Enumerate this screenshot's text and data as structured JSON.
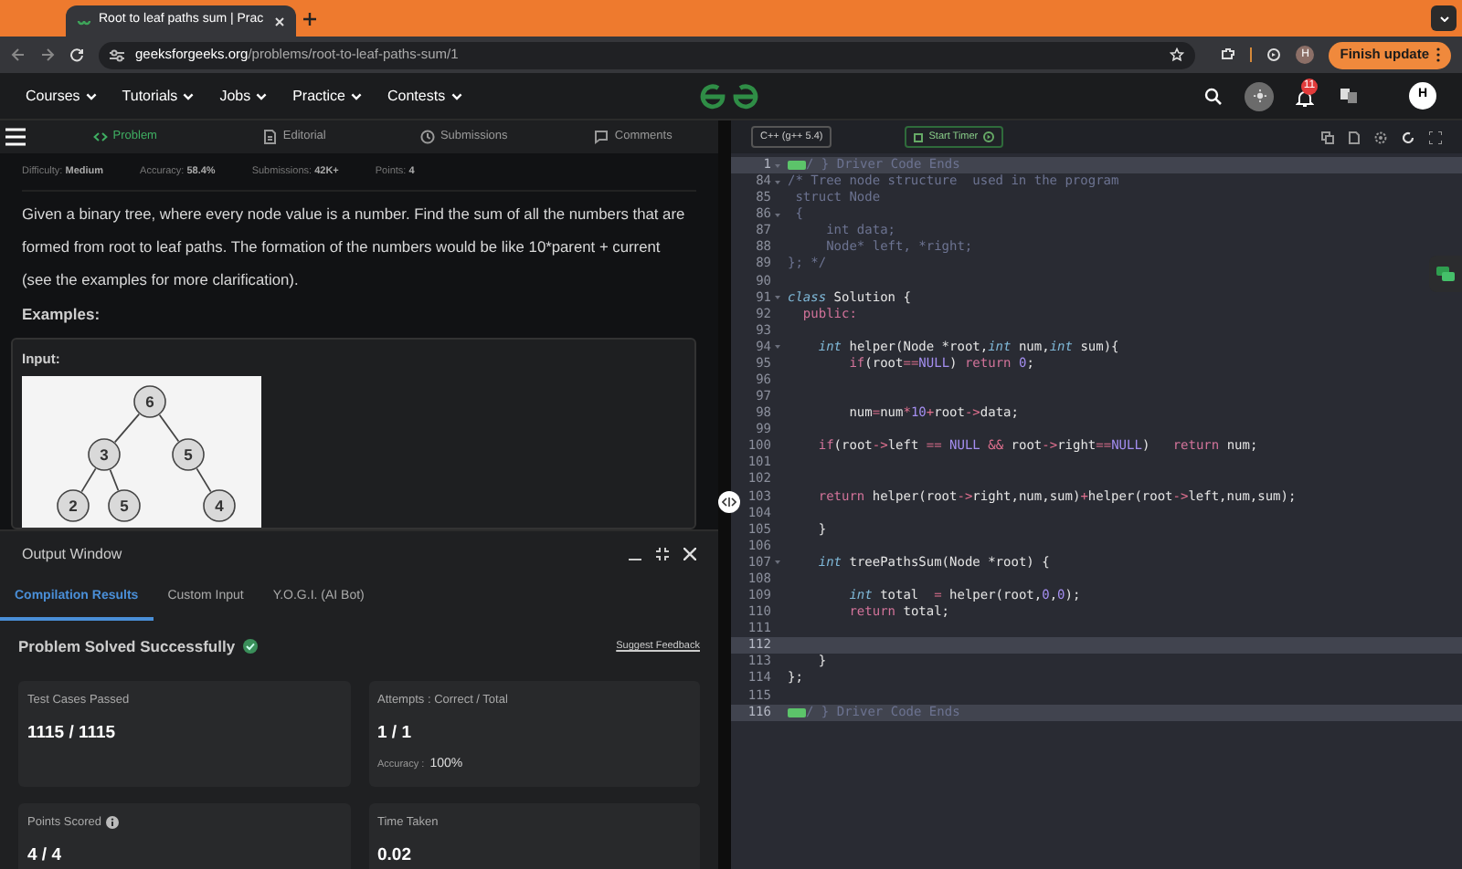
{
  "browser": {
    "tab_title": "Root to leaf paths sum | Prac",
    "url_domain": "geeksforgeeks.org",
    "url_path": "/problems/root-to-leaf-paths-sum/1",
    "profile_initial": "H",
    "update_button": "Finish update"
  },
  "site_nav": {
    "items": [
      "Courses",
      "Tutorials",
      "Jobs",
      "Practice",
      "Contests"
    ],
    "notification_count": "11",
    "avatar_initial": "H"
  },
  "problem_tabs": [
    {
      "label": "Problem",
      "kind": "code",
      "selected": true
    },
    {
      "label": "Editorial",
      "kind": "doc",
      "selected": false
    },
    {
      "label": "Submissions",
      "kind": "clock",
      "selected": false
    },
    {
      "label": "Comments",
      "kind": "chat",
      "selected": false
    }
  ],
  "meta": [
    {
      "label": "Difficulty:",
      "value": "Medium"
    },
    {
      "label": "Accuracy:",
      "value": "58.4%"
    },
    {
      "label": "Submissions:",
      "value": "42K+"
    },
    {
      "label": "Points:",
      "value": "4"
    }
  ],
  "description": "Given a binary tree, where every node value is a number. Find the sum of all the numbers that are formed from root to leaf paths. The formation of the numbers would be like 10*parent + current (see the examples for more clarification).",
  "examples_heading": "Examples:",
  "example": {
    "label": "Input:",
    "tree": {
      "value": "6",
      "children": [
        {
          "value": "3",
          "children": [
            {
              "value": "2"
            },
            {
              "value": "5"
            }
          ]
        },
        {
          "value": "5",
          "children": [
            {
              "value": "4"
            }
          ]
        }
      ]
    }
  },
  "output_window": {
    "title": "Output Window",
    "tabs": [
      {
        "label": "Compilation Results",
        "selected": true
      },
      {
        "label": "Custom Input",
        "selected": false
      },
      {
        "label": "Y.O.G.I. (AI Bot)",
        "selected": false
      }
    ],
    "status": "Problem Solved Successfully",
    "feedback_link": "Suggest Feedback",
    "cards": [
      {
        "label": "Test Cases Passed",
        "value": "1115 / 1115",
        "info": false
      },
      {
        "label": "Attempts : Correct / Total",
        "value": "1 / 1",
        "info": false,
        "extra_label": "Accuracy :",
        "extra_value": "100%"
      },
      {
        "label": "Points Scored",
        "value": "4 / 4",
        "info": true
      },
      {
        "label": "Time Taken",
        "value": "0.02",
        "info": false
      }
    ]
  },
  "editor": {
    "language": "C++ (g++ 5.4)",
    "timer_button": "Start Timer",
    "lines": [
      {
        "number": "1",
        "foldable": true,
        "folded": true,
        "highlighted": true,
        "tokens": [
          {
            "text": "/ } Driver Code Ends",
            "kind": "comment"
          }
        ]
      },
      {
        "number": "84",
        "foldable": true,
        "folded": false,
        "highlighted": false,
        "tokens": [
          {
            "text": "/* Tree node structure  used in the program",
            "kind": "comment"
          }
        ]
      },
      {
        "number": "85",
        "foldable": false,
        "folded": false,
        "highlighted": false,
        "tokens": [
          {
            "text": " struct Node",
            "kind": "comment"
          }
        ]
      },
      {
        "number": "86",
        "foldable": true,
        "folded": false,
        "highlighted": false,
        "tokens": [
          {
            "text": " {",
            "kind": "comment"
          }
        ]
      },
      {
        "number": "87",
        "foldable": false,
        "folded": false,
        "highlighted": false,
        "tokens": [
          {
            "text": "     int data;",
            "kind": "comment"
          }
        ]
      },
      {
        "number": "88",
        "foldable": false,
        "folded": false,
        "highlighted": false,
        "tokens": [
          {
            "text": "     Node* left, *right;",
            "kind": "comment"
          }
        ]
      },
      {
        "number": "89",
        "foldable": false,
        "folded": false,
        "highlighted": false,
        "tokens": [
          {
            "text": "}; */",
            "kind": "comment"
          }
        ]
      },
      {
        "number": "90",
        "foldable": false,
        "folded": false,
        "highlighted": false
      },
      {
        "number": "91",
        "foldable": true,
        "folded": false,
        "highlighted": false,
        "tokens": [
          {
            "text": "class",
            "kind": "type"
          },
          {
            "text": " Solution {",
            "kind": "plain"
          }
        ]
      },
      {
        "number": "92",
        "foldable": false,
        "folded": false,
        "highlighted": false,
        "tokens": [
          {
            "text": "  public:",
            "kind": "control"
          }
        ]
      },
      {
        "number": "93",
        "foldable": false,
        "folded": false,
        "highlighted": false
      },
      {
        "number": "94",
        "foldable": true,
        "folded": false,
        "highlighted": false,
        "tokens": [
          {
            "text": "    int",
            "kind": "type"
          },
          {
            "text": " helper(Node *root,",
            "kind": "plain"
          },
          {
            "text": "int",
            "kind": "type"
          },
          {
            "text": " num,",
            "kind": "plain"
          },
          {
            "text": "int",
            "kind": "type"
          },
          {
            "text": " sum){",
            "kind": "plain"
          }
        ]
      },
      {
        "number": "95",
        "foldable": false,
        "folded": false,
        "highlighted": false,
        "tokens": [
          {
            "text": "        if",
            "kind": "control"
          },
          {
            "text": "(root",
            "kind": "plain"
          },
          {
            "text": "==",
            "kind": "operator"
          },
          {
            "text": "NULL",
            "kind": "constant"
          },
          {
            "text": ") ",
            "kind": "plain"
          },
          {
            "text": "return",
            "kind": "control"
          },
          {
            "text": " 0",
            "kind": "constant"
          },
          {
            "text": ";",
            "kind": "plain"
          }
        ]
      },
      {
        "number": "96",
        "foldable": false,
        "folded": false,
        "highlighted": false
      },
      {
        "number": "97",
        "foldable": false,
        "folded": false,
        "highlighted": false
      },
      {
        "number": "98",
        "foldable": false,
        "folded": false,
        "highlighted": false,
        "tokens": [
          {
            "text": "        num",
            "kind": "plain"
          },
          {
            "text": "=",
            "kind": "operator"
          },
          {
            "text": "num",
            "kind": "plain"
          },
          {
            "text": "*",
            "kind": "operator"
          },
          {
            "text": "10",
            "kind": "constant"
          },
          {
            "text": "+",
            "kind": "operator"
          },
          {
            "text": "root",
            "kind": "plain"
          },
          {
            "text": "->",
            "kind": "operator"
          },
          {
            "text": "data;",
            "kind": "plain"
          }
        ]
      },
      {
        "number": "99",
        "foldable": false,
        "folded": false,
        "highlighted": false
      },
      {
        "number": "100",
        "foldable": false,
        "folded": false,
        "highlighted": false,
        "tokens": [
          {
            "text": "    if",
            "kind": "control"
          },
          {
            "text": "(root",
            "kind": "plain"
          },
          {
            "text": "->",
            "kind": "operator"
          },
          {
            "text": "left ",
            "kind": "plain"
          },
          {
            "text": "==",
            "kind": "operator"
          },
          {
            "text": " NULL ",
            "kind": "constant"
          },
          {
            "text": "&&",
            "kind": "operator"
          },
          {
            "text": " root",
            "kind": "plain"
          },
          {
            "text": "->",
            "kind": "operator"
          },
          {
            "text": "right",
            "kind": "plain"
          },
          {
            "text": "==",
            "kind": "operator"
          },
          {
            "text": "NULL",
            "kind": "constant"
          },
          {
            "text": ")   ",
            "kind": "plain"
          },
          {
            "text": "return",
            "kind": "control"
          },
          {
            "text": " num;",
            "kind": "plain"
          }
        ]
      },
      {
        "number": "101",
        "foldable": false,
        "folded": false,
        "highlighted": false
      },
      {
        "number": "102",
        "foldable": false,
        "folded": false,
        "highlighted": false
      },
      {
        "number": "103",
        "foldable": false,
        "folded": false,
        "highlighted": false,
        "tokens": [
          {
            "text": "    return",
            "kind": "control"
          },
          {
            "text": " helper(root",
            "kind": "plain"
          },
          {
            "text": "->",
            "kind": "operator"
          },
          {
            "text": "right,num,sum)",
            "kind": "plain"
          },
          {
            "text": "+",
            "kind": "operator"
          },
          {
            "text": "helper(root",
            "kind": "plain"
          },
          {
            "text": "->",
            "kind": "operator"
          },
          {
            "text": "left,num,sum);",
            "kind": "plain"
          }
        ]
      },
      {
        "number": "104",
        "foldable": false,
        "folded": false,
        "highlighted": false
      },
      {
        "number": "105",
        "foldable": false,
        "folded": false,
        "highlighted": false,
        "tokens": [
          {
            "text": "    }",
            "kind": "plain"
          }
        ]
      },
      {
        "number": "106",
        "foldable": false,
        "folded": false,
        "highlighted": false
      },
      {
        "number": "107",
        "foldable": true,
        "folded": false,
        "highlighted": false,
        "tokens": [
          {
            "text": "    int",
            "kind": "type"
          },
          {
            "text": " treePathsSum(Node *root) {",
            "kind": "plain"
          }
        ]
      },
      {
        "number": "108",
        "foldable": false,
        "folded": false,
        "highlighted": false
      },
      {
        "number": "109",
        "foldable": false,
        "folded": false,
        "highlighted": false,
        "tokens": [
          {
            "text": "        int",
            "kind": "type"
          },
          {
            "text": " total  ",
            "kind": "plain"
          },
          {
            "text": "=",
            "kind": "operator"
          },
          {
            "text": " helper(root,",
            "kind": "plain"
          },
          {
            "text": "0",
            "kind": "constant"
          },
          {
            "text": ",",
            "kind": "plain"
          },
          {
            "text": "0",
            "kind": "constant"
          },
          {
            "text": ");",
            "kind": "plain"
          }
        ]
      },
      {
        "number": "110",
        "foldable": false,
        "folded": false,
        "highlighted": false,
        "tokens": [
          {
            "text": "        return",
            "kind": "control"
          },
          {
            "text": " total;",
            "kind": "plain"
          }
        ]
      },
      {
        "number": "111",
        "foldable": false,
        "folded": false,
        "highlighted": false
      },
      {
        "number": "112",
        "foldable": false,
        "folded": false,
        "highlighted": true
      },
      {
        "number": "113",
        "foldable": false,
        "folded": false,
        "highlighted": false,
        "tokens": [
          {
            "text": "    }",
            "kind": "plain"
          }
        ]
      },
      {
        "number": "114",
        "foldable": false,
        "folded": false,
        "highlighted": false,
        "tokens": [
          {
            "text": "};",
            "kind": "plain"
          }
        ]
      },
      {
        "number": "115",
        "foldable": false,
        "folded": false,
        "highlighted": false
      },
      {
        "number": "116",
        "foldable": false,
        "folded": true,
        "highlighted": true,
        "tokens": [
          {
            "text": "/ } Driver Code Ends",
            "kind": "comment"
          }
        ]
      }
    ]
  }
}
